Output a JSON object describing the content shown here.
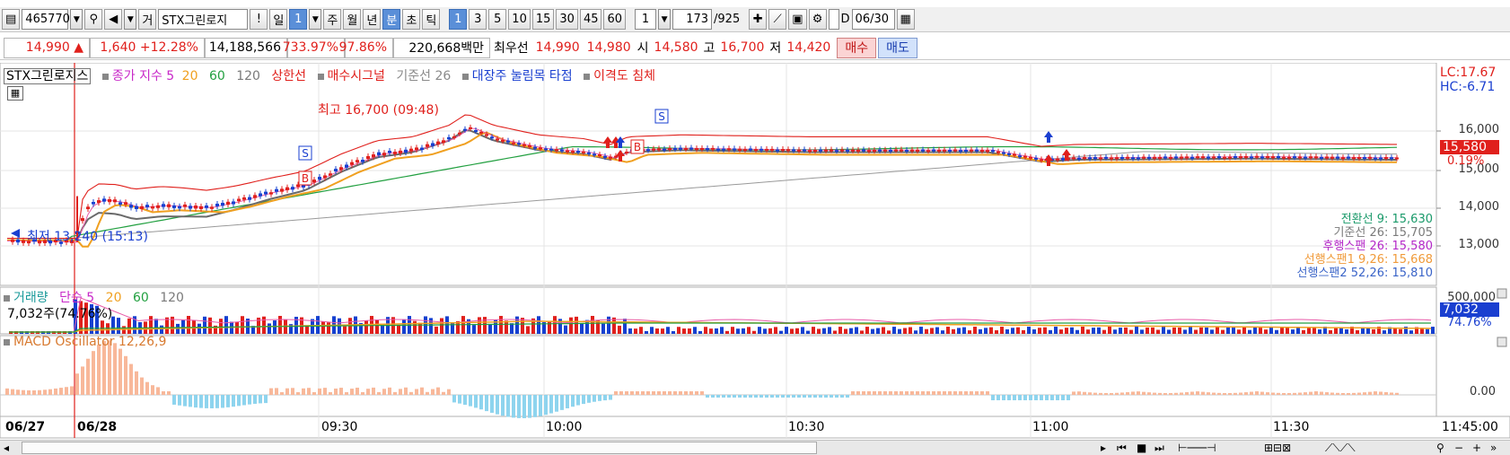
{
  "toolbar": {
    "code": "465770",
    "type_label": "거",
    "name": "STX그린로지",
    "warn": "!",
    "period_day": "일",
    "period_num": "1",
    "period_week": "주",
    "period_month": "월",
    "period_year": "년",
    "period_min": "분",
    "period_sec": "초",
    "period_tick": "틱",
    "intervals": [
      "1",
      "3",
      "5",
      "10",
      "15",
      "30",
      "45",
      "60"
    ],
    "count_value": "1",
    "bars_value": "173",
    "bars_total": "/925",
    "check_label": "D",
    "date_value": "06/30"
  },
  "quote": {
    "price": "14,990 ▲",
    "change": "1,640",
    "change_pct": "+12.28%",
    "volume": "14,188,566",
    "vol_ratio": "733.97%",
    "ratio2": "97.86%",
    "amount": "220,668백만",
    "best_label": "최우선",
    "ask": "14,990",
    "bid": "14,980",
    "open_label": "시",
    "open": "14,580",
    "high_label": "고",
    "high": "16,700",
    "low_label": "저",
    "low": "14,420",
    "buy_label": "매수",
    "sell_label": "매도"
  },
  "price_panel": {
    "legend": {
      "stock_name": "STX그린로지스",
      "close_ma": "종가 지수 5",
      "ma20": "20",
      "ma60": "60",
      "ma120": "120",
      "limit_up": "상한선",
      "buy_signal": "매수시그널",
      "base_line": "기준선 26",
      "pullback": "대장주 눌림목 타점",
      "divergence": "이격도 침체"
    },
    "right_top": {
      "lc": "LC:17.67",
      "hc": "HC:-6.71"
    },
    "y_ticks": [
      "16,000",
      "15,000",
      "14,000",
      "13,000"
    ],
    "last_tag": "15,580",
    "last_pct": "0.19%",
    "high_annot": "최고 16,700 (09:48)",
    "low_annot": "최저 13,240 (15:13)",
    "ichimoku": [
      {
        "text": "전환선 9: 15,630",
        "color": "#1a9a6a"
      },
      {
        "text": "기준선 26: 15,705",
        "color": "#7a7a7a"
      },
      {
        "text": "후행스팬 26: 15,580",
        "color": "#b428c8"
      },
      {
        "text": "선행스팬1 9,26: 15,668",
        "color": "#f09a3a"
      },
      {
        "text": "선행스팬2 52,26: 15,810",
        "color": "#3a64c8"
      }
    ],
    "signal_b": "B",
    "signal_s": "S"
  },
  "volume_panel": {
    "legend": {
      "name": "거래량",
      "simple": "단순 5",
      "ma20": "20",
      "ma60": "60",
      "ma120": "120"
    },
    "cur": "7,032주(74.76%)",
    "y_tick": "500,000",
    "tag": "7,032",
    "tag_pct": "74.76%"
  },
  "macd_panel": {
    "legend": "MACD Oscillator 12,26,9",
    "y_tick": "0.00"
  },
  "time_axis": {
    "left_date": "06/27",
    "labels": [
      "06/28",
      "09:30",
      "10:00",
      "10:30",
      "11:00",
      "11:30"
    ],
    "right_time": "11:45:00"
  },
  "colors": {
    "up": "#e0201c",
    "down": "#1540d0",
    "ma5": "#e0201c",
    "ma20": "#f0a020",
    "ma60": "#22a040",
    "ma120": "#7a7a7a",
    "macd_pos": "#f8b89a",
    "macd_neg": "#8ed4ee"
  }
}
